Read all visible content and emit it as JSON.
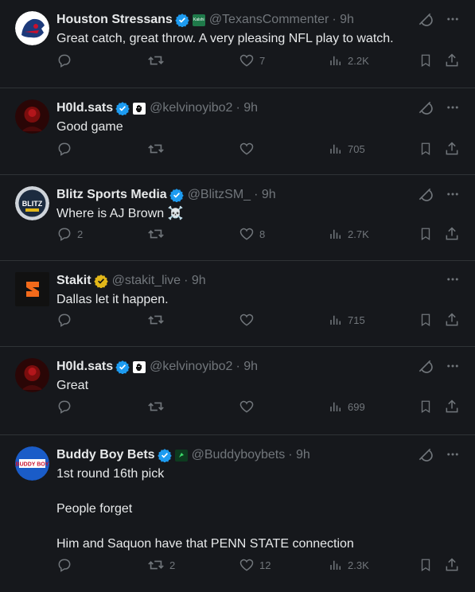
{
  "tweets": [
    {
      "name": "Houston Stressans",
      "handle": "@TexansCommenter",
      "time": "· 9h",
      "text": "Great catch, great throw. A very pleasing NFL play to watch.",
      "badge": "blue",
      "aff": "kalshi",
      "replies": "",
      "retweets": "",
      "likes": "7",
      "views": "2.2K"
    },
    {
      "name": "H0ld.sats",
      "handle": "@kelvinoyibo2",
      "time": "· 9h",
      "text": "Good game",
      "badge": "blue",
      "aff": "hand",
      "replies": "",
      "retweets": "",
      "likes": "",
      "views": "705"
    },
    {
      "name": "Blitz Sports Media",
      "handle": "@BlitzSM_",
      "time": "· 9h",
      "text": "Where is AJ Brown ☠️",
      "badge": "blue",
      "aff": "",
      "replies": "2",
      "retweets": "",
      "likes": "8",
      "views": "2.7K"
    },
    {
      "name": "Stakit",
      "handle": "@stakit_live",
      "time": "· 9h",
      "text": "Dallas let it happen.",
      "badge": "gold",
      "aff": "",
      "replies": "",
      "retweets": "",
      "likes": "",
      "views": "715"
    },
    {
      "name": "H0ld.sats",
      "handle": "@kelvinoyibo2",
      "time": "· 9h",
      "text": "Great",
      "badge": "blue",
      "aff": "hand",
      "replies": "",
      "retweets": "",
      "likes": "",
      "views": "699"
    },
    {
      "name": "Buddy Boy Bets",
      "handle": "@Buddyboybets",
      "time": "· 9h",
      "text": "1st round 16th pick\n\nPeople forget\n\nHim and Saquon have that PENN STATE connection",
      "badge": "blue",
      "aff": "green",
      "replies": "",
      "retweets": "2",
      "likes": "12",
      "views": "2.3K"
    }
  ],
  "avatar_labels": {
    "kalshi": "Kalshi",
    "blitz": "BLITZ",
    "buddy": "BUDDY BOY"
  },
  "colors": {
    "bg": "#16181c",
    "divider": "#2f3336",
    "text": "#e7e9ea",
    "muted": "#71767b",
    "verified_blue": "#1d9bf0",
    "verified_gold": "#e2b719"
  },
  "icons": [
    "reply-icon",
    "retweet-icon",
    "like-icon",
    "views-icon",
    "bookmark-icon",
    "share-icon",
    "grok-icon",
    "more-icon",
    "verified-badge-icon"
  ]
}
